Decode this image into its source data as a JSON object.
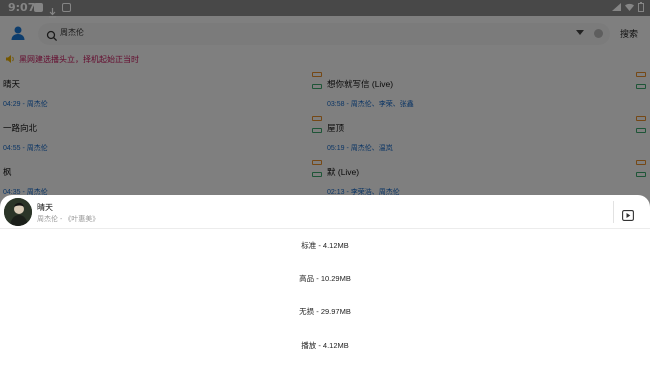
{
  "statusbar": {
    "time": "9:07"
  },
  "search": {
    "query": "周杰伦",
    "button_label": "搜索"
  },
  "notice": {
    "text": "黑网建选播头立，择机起始正当时"
  },
  "songs": [
    {
      "title": "晴天",
      "meta": "04:29 - 周杰伦"
    },
    {
      "title": "想你就写信 (Live)",
      "meta": "03:58 - 周杰伦、李荣、张鑫"
    },
    {
      "title": "一路向北",
      "meta": "04:55 - 周杰伦"
    },
    {
      "title": "屋顶",
      "meta": "05:19 - 周杰伦、温岚"
    },
    {
      "title": "枫",
      "meta": "04:35 - 周杰伦"
    },
    {
      "title": "默 (Live)",
      "meta": "02:13 - 李荣浩、周杰伦"
    }
  ],
  "sheet": {
    "title": "晴天",
    "subtitle": "周杰伦 - 《叶惠美》",
    "options": [
      "标准 - 4.12MB",
      "高品 - 10.29MB",
      "无损 - 29.97MB",
      "播放 - 4.12MB"
    ]
  },
  "colors": {
    "accent_link": "#1565c0",
    "notice": "#c0185a",
    "tag_orange": "#e08a2a",
    "tag_green": "#3aa36a"
  },
  "icons": [
    "user-icon",
    "search-icon",
    "dropdown-icon",
    "clear-icon",
    "speaker-icon",
    "video-icon"
  ]
}
